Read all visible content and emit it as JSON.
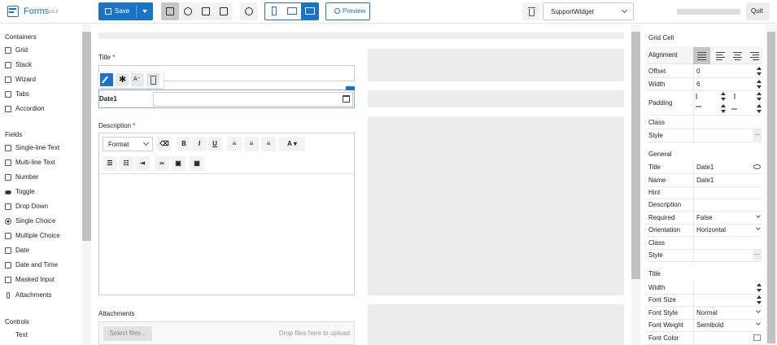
{
  "app": {
    "title": "Forms",
    "version": "1.6.2"
  },
  "toolbar": {
    "save_label": "Save",
    "preview_label": "Preview",
    "widget_select": "SupportWidget",
    "quit_label": "Quit"
  },
  "sidebar": {
    "containers_title": "Containers",
    "containers": [
      {
        "label": "Grid",
        "icon": "grid-icon"
      },
      {
        "label": "Stack",
        "icon": "stack-icon"
      },
      {
        "label": "Wizard",
        "icon": "wizard-icon"
      },
      {
        "label": "Tabs",
        "icon": "tabs-icon"
      },
      {
        "label": "Accordion",
        "icon": "accordion-icon"
      }
    ],
    "fields_title": "Fields",
    "fields": [
      {
        "label": "Single-line Text",
        "icon": "single-line-text-icon"
      },
      {
        "label": "Multi-line Text",
        "icon": "multi-line-text-icon"
      },
      {
        "label": "Number",
        "icon": "number-icon"
      },
      {
        "label": "Toggle",
        "icon": "toggle-icon"
      },
      {
        "label": "Drop Down",
        "icon": "drop-down-icon"
      },
      {
        "label": "Single Choice",
        "icon": "radio-icon"
      },
      {
        "label": "Multiple Choice",
        "icon": "checkbox-icon"
      },
      {
        "label": "Date",
        "icon": "calendar-icon"
      },
      {
        "label": "Date and Time",
        "icon": "calendar-clock-icon"
      },
      {
        "label": "Masked Input",
        "icon": "masked-input-icon"
      },
      {
        "label": "Attachments",
        "icon": "paperclip-icon"
      }
    ],
    "controls_title": "Controls",
    "controls": [
      {
        "label": "Text",
        "icon": "text-icon"
      }
    ]
  },
  "canvas": {
    "title_label": "Title",
    "date_label": "Date1",
    "description_label": "Description",
    "format_label": "Format",
    "attachments_label": "Attachments",
    "select_files": "Select files...",
    "drop_hint": "Drop files here to upload"
  },
  "props": {
    "grid_cell_title": "Grid Cell",
    "alignment_label": "Alignment",
    "offset_label": "Offset",
    "offset_value": "0",
    "width_label": "Width",
    "width_value": "6",
    "padding_label": "Padding",
    "class_label": "Class",
    "style_label": "Style",
    "general_title": "General",
    "general": [
      {
        "key": "Title",
        "value": "Date1"
      },
      {
        "key": "Name",
        "value": "Date1"
      },
      {
        "key": "Hint",
        "value": ""
      },
      {
        "key": "Description",
        "value": ""
      },
      {
        "key": "Required",
        "value": "False"
      },
      {
        "key": "Orientation",
        "value": "Horizontal"
      },
      {
        "key": "Class",
        "value": ""
      },
      {
        "key": "Style",
        "value": ""
      }
    ],
    "title_section": "Title",
    "title_props": [
      {
        "key": "Width",
        "value": ""
      },
      {
        "key": "Font Size",
        "value": ""
      },
      {
        "key": "Font Style",
        "value": "Normal"
      },
      {
        "key": "Font Weight",
        "value": "Semibold"
      },
      {
        "key": "Font Color",
        "value": ""
      }
    ]
  },
  "colors": {
    "accent": "#1a73c7",
    "required": "#cc0000"
  }
}
